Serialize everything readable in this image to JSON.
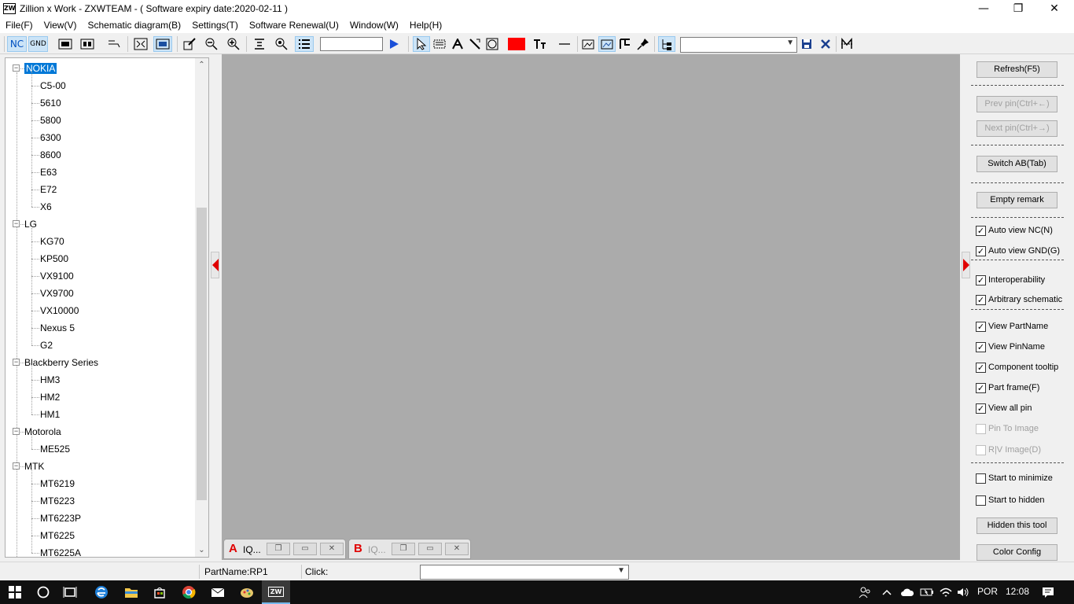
{
  "window": {
    "logo": "ZW",
    "title": "Zillion x Work - ZXWTEAM - ( Software expiry date:2020-02-11 )",
    "minimize": "—",
    "restore": "❐",
    "close": "✕"
  },
  "menu": [
    "File(F)",
    "View(V)",
    "Schematic diagram(B)",
    "Settings(T)",
    "Software Renewal(U)",
    "Window(W)",
    "Help(H)"
  ],
  "toolbar": {
    "nc": "NC",
    "gnd": "GND",
    "search_value": "",
    "combo_value": ""
  },
  "tree": {
    "groups": [
      {
        "label": "NOKIA",
        "selected": true,
        "children": [
          "C5-00",
          "5610",
          "5800",
          "6300",
          "8600",
          "E63",
          "E72",
          "X6"
        ]
      },
      {
        "label": "LG",
        "children": [
          "KG70",
          "KP500",
          "VX9100",
          "VX9700",
          "VX10000",
          "Nexus 5",
          "G2"
        ]
      },
      {
        "label": "Blackberry Series",
        "children": [
          "HM3",
          "HM2",
          "HM1"
        ]
      },
      {
        "label": "Motorola",
        "children": [
          "ME525"
        ]
      },
      {
        "label": "MTK",
        "children": [
          "MT6219",
          "MT6223",
          "MT6223P",
          "MT6225",
          "MT6225A"
        ]
      }
    ]
  },
  "tabs": [
    {
      "letter": "A",
      "name": "IQ...",
      "active": true
    },
    {
      "letter": "B",
      "name": "IQ...",
      "active": false
    }
  ],
  "right_panel": {
    "refresh": "Refresh(F5)",
    "prev_pin": "Prev pin(Ctrl+←)",
    "next_pin": "Next pin(Ctrl+→)",
    "switch_ab": "Switch AB(Tab)",
    "empty_remark": "Empty remark",
    "hidden_tool": "Hidden this tool",
    "color_config": "Color Config",
    "checks": [
      {
        "label": "Auto view NC(N)",
        "checked": true
      },
      {
        "label": "Auto view GND(G)",
        "checked": true
      },
      {
        "label": "Interoperability",
        "checked": true
      },
      {
        "label": "Arbitrary schematic",
        "checked": true
      },
      {
        "label": "View PartName",
        "checked": true
      },
      {
        "label": "View PinName",
        "checked": true
      },
      {
        "label": "Component tooltip",
        "checked": true
      },
      {
        "label": "Part frame(F)",
        "checked": true
      },
      {
        "label": "View all pin",
        "checked": true
      },
      {
        "label": "Pin To Image",
        "checked": false,
        "disabled": true
      },
      {
        "label": "R|V Image(D)",
        "checked": false,
        "disabled": true
      },
      {
        "label": "Start to minimize",
        "checked": false
      },
      {
        "label": "Start to hidden",
        "checked": false
      }
    ]
  },
  "status": {
    "partname": "PartName:RP1",
    "click": "Click:",
    "combo_value": ""
  },
  "taskbar": {
    "language": "POR",
    "time": "12:08",
    "app_label": "ZW"
  },
  "colors": {
    "accent": "#0078d7",
    "red": "#ff0000",
    "workspace": "#ababab"
  }
}
